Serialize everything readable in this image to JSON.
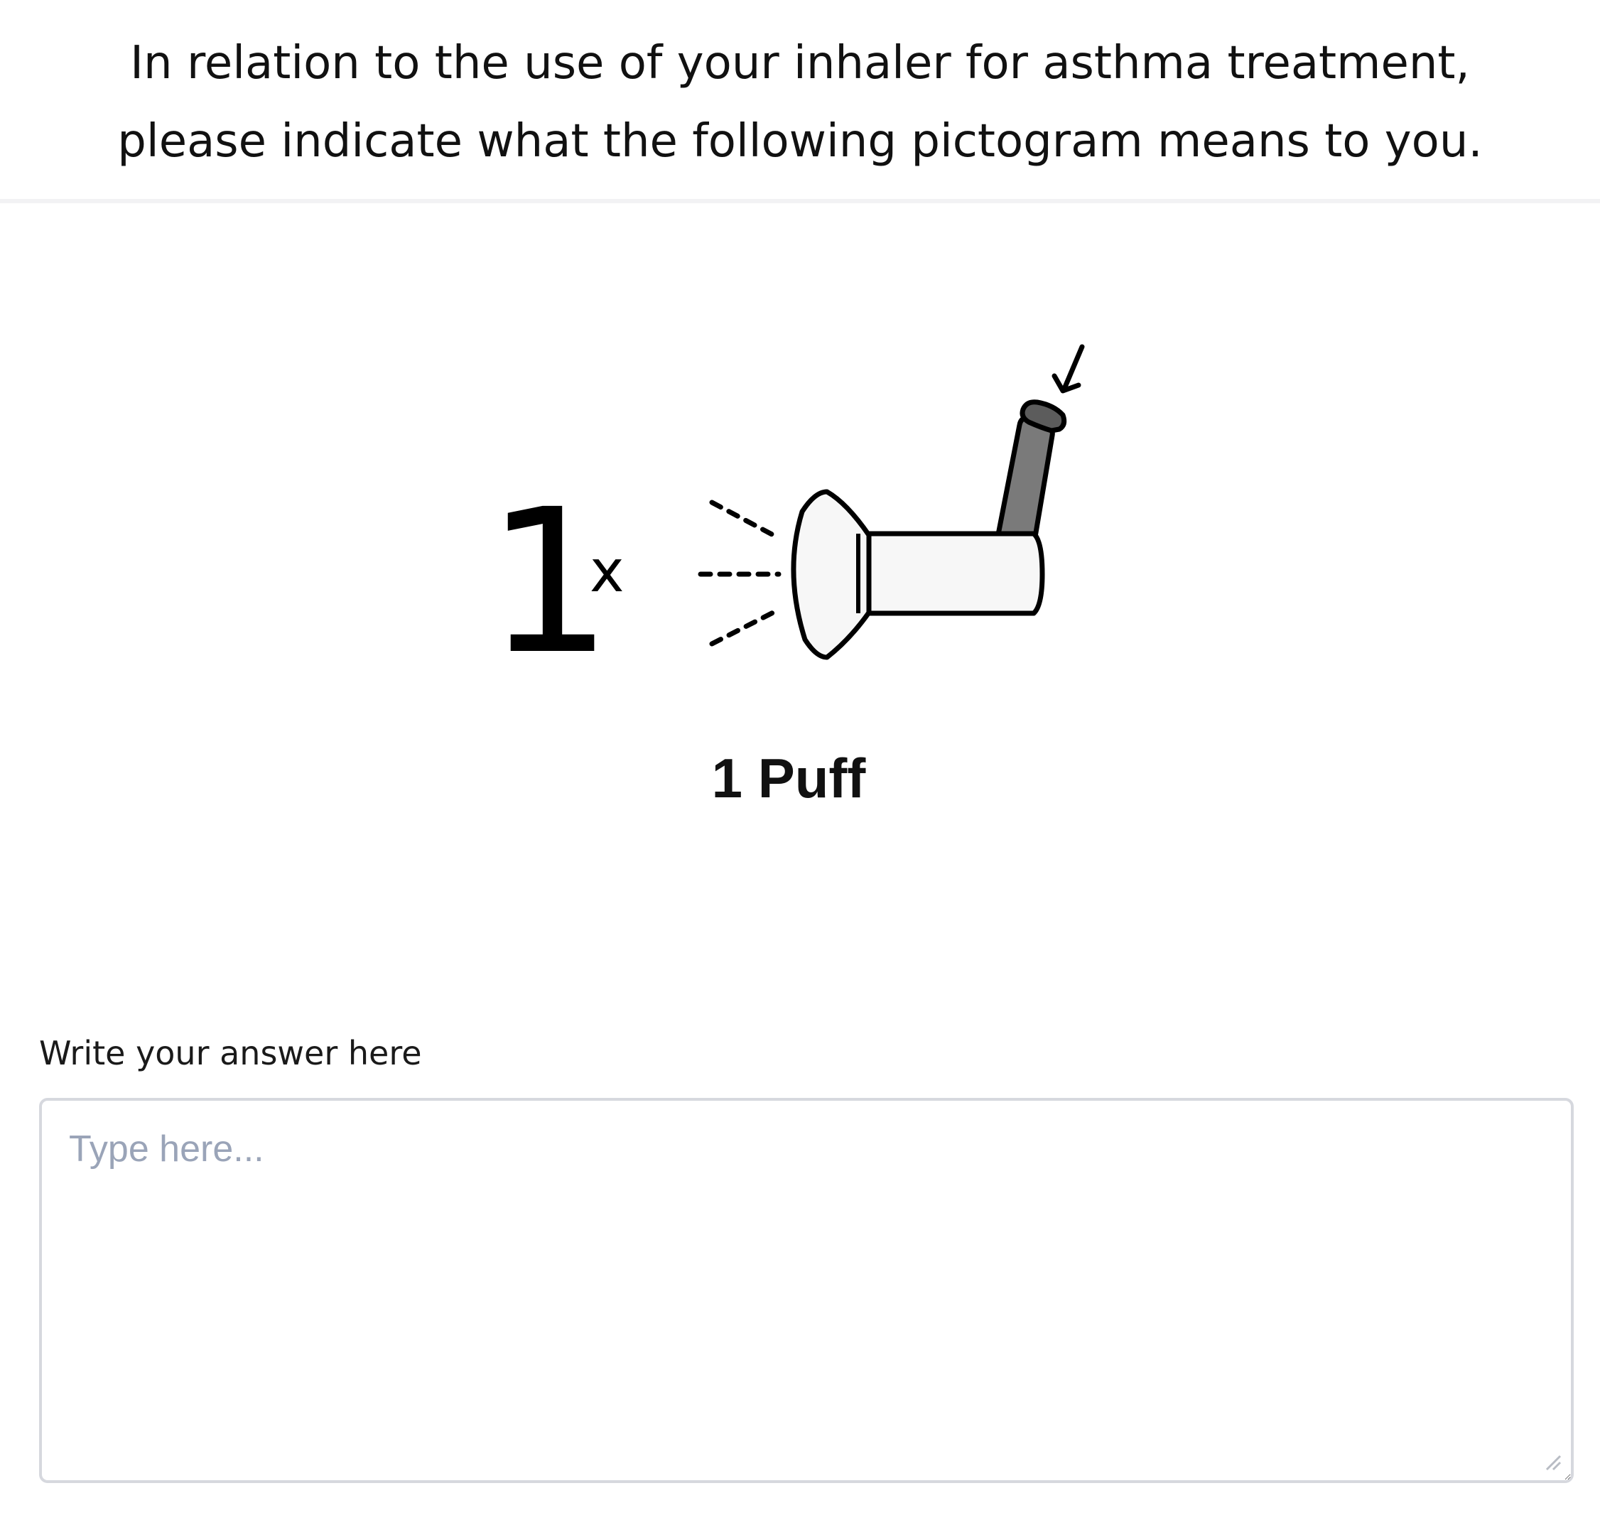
{
  "question": {
    "title_line1": "In relation to the use of your inhaler for asthma treatment,",
    "title_line2": "please indicate what the following pictogram means to you."
  },
  "pictogram": {
    "dose_number": "1",
    "dose_multiplier": "x",
    "caption": "1 Puff",
    "icon": "inhaler-icon",
    "press_icon": "press-arrow-icon",
    "colors": {
      "outline": "#000000",
      "body_fill": "#f7f7f7",
      "canister_fill": "#7a7a7a",
      "cap_fill": "#5c5c5c"
    }
  },
  "answer": {
    "label": "Write your answer here",
    "placeholder": "Type here...",
    "value": ""
  }
}
